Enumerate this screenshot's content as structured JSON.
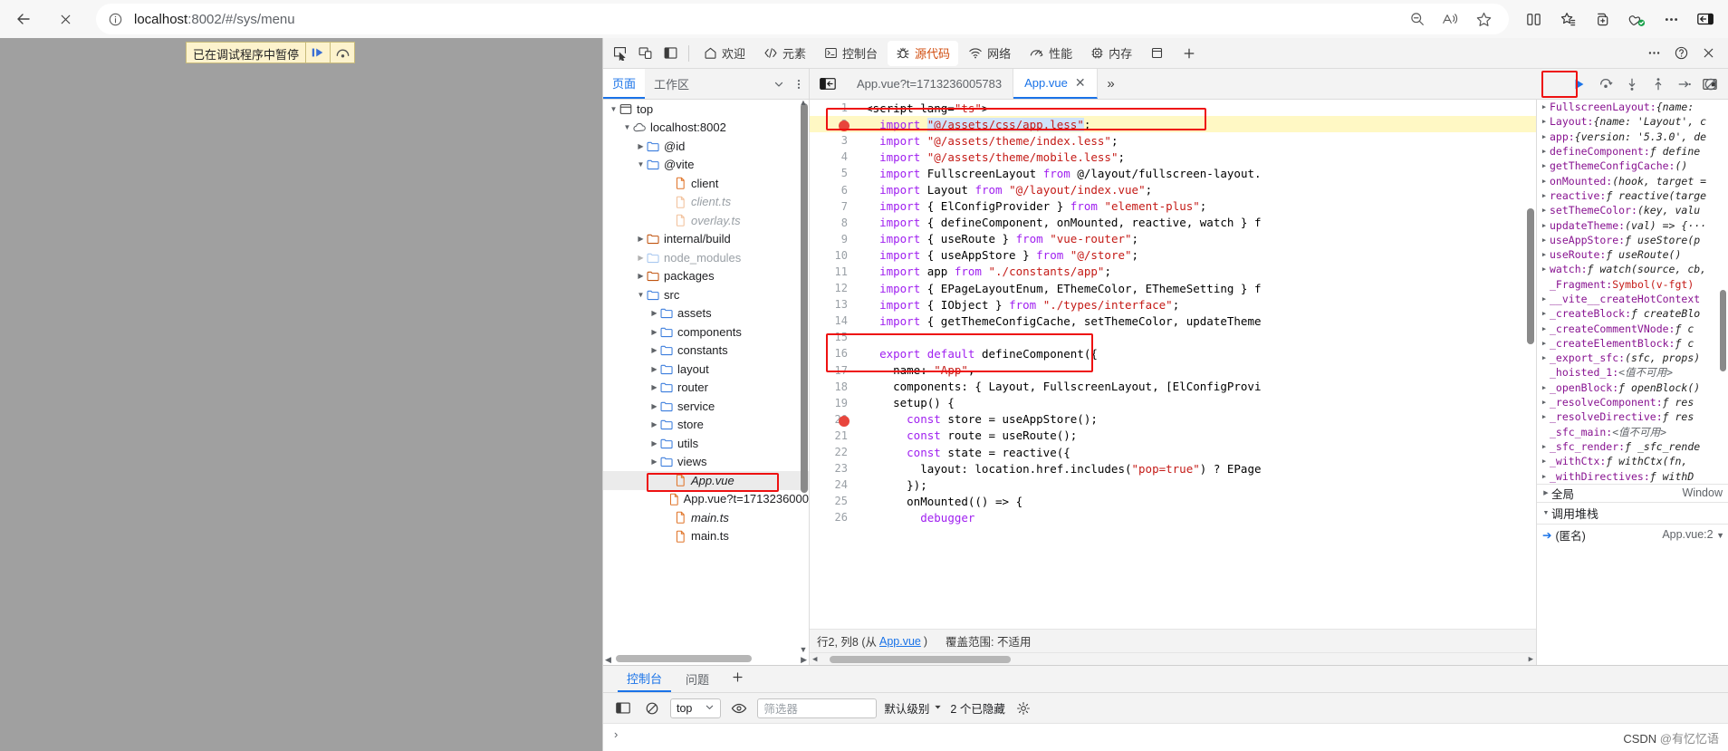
{
  "browser": {
    "back_label": "back-arrow",
    "stop_label": "stop",
    "url_prefix": "localhost",
    "url_rest": ":8002/#/sys/menu",
    "icons": {
      "info": "info-icon",
      "zoom_out": "zoom-out-icon",
      "read_aloud": "read-aloud-icon",
      "favorite": "favorite-star-icon",
      "split_screen": "split-screen-icon",
      "collections": "collections-icon",
      "add_tab_group": "add-tab-group-icon",
      "browser_essentials": "browser-essentials-icon",
      "settings_more": "settings-and-more-icon",
      "sidebar": "sidebar-icon"
    }
  },
  "page_overlay": {
    "paused_text": "已在调试程序中暂停",
    "resume_icon": "resume-script-icon",
    "step_icon": "step-over-icon"
  },
  "devtools": {
    "toolbar_icons": {
      "inspect": "inspect-element-icon",
      "device": "device-toolbar-icon",
      "dock": "dock-side-icon",
      "more": "more-tools-icon",
      "help": "help-icon",
      "close": "close-devtools-icon",
      "add_panel": "add-panel-icon"
    },
    "tabs": [
      {
        "label": "欢迎",
        "icon": "home-icon",
        "active": false
      },
      {
        "label": "元素",
        "icon": "elements-icon",
        "active": false
      },
      {
        "label": "控制台",
        "icon": "console-icon",
        "active": false
      },
      {
        "label": "源代码",
        "icon": "sources-bug-icon",
        "active": true
      },
      {
        "label": "网络",
        "icon": "network-icon",
        "active": false
      },
      {
        "label": "性能",
        "icon": "performance-icon",
        "active": false
      },
      {
        "label": "内存",
        "icon": "memory-icon",
        "active": false
      },
      {
        "label": "应用",
        "icon": "application-icon",
        "active": false
      }
    ],
    "navigator": {
      "tabs": [
        {
          "label": "页面",
          "active": true
        },
        {
          "label": "工作区",
          "active": false
        }
      ],
      "chevron_icon": "chevron-down-icon",
      "more_icon": "more-options-icon"
    },
    "editor_tabs": {
      "show_navigator_icon": "show-navigator-icon",
      "tabs": [
        {
          "label": "App.vue?t=1713236005783",
          "active": false,
          "closable": false
        },
        {
          "label": "App.vue",
          "active": true,
          "closable": true
        }
      ],
      "more_icon": "more-tabs-icon",
      "popout_icon": "popout-editor-icon"
    },
    "debug_controls": [
      {
        "name": "resume-script-execution",
        "icon": "resume-icon",
        "highlighted": true
      },
      {
        "name": "step-over-next-function-call",
        "icon": "step-over-icon",
        "highlighted": false
      },
      {
        "name": "step-into-next-function-call",
        "icon": "step-into-icon",
        "highlighted": false
      },
      {
        "name": "step-out-of-current-function",
        "icon": "step-out-icon",
        "highlighted": false
      },
      {
        "name": "step",
        "icon": "step-icon",
        "highlighted": false
      },
      {
        "name": "deactivate-breakpoints",
        "icon": "deactivate-breakpoints-icon",
        "highlighted": false
      }
    ],
    "file_tree": [
      {
        "label": "top",
        "indent": 0,
        "arrow": "down",
        "icon": "frame-icon",
        "style": ""
      },
      {
        "label": "localhost:8002",
        "indent": 1,
        "arrow": "down",
        "icon": "cloud-icon",
        "style": ""
      },
      {
        "label": "@id",
        "indent": 2,
        "arrow": "right",
        "icon": "folder-blue",
        "style": ""
      },
      {
        "label": "@vite",
        "indent": 2,
        "arrow": "down",
        "icon": "folder-blue",
        "style": ""
      },
      {
        "label": "client",
        "indent": 4,
        "arrow": "none",
        "icon": "file-orange",
        "style": ""
      },
      {
        "label": "client.ts",
        "indent": 4,
        "arrow": "none",
        "icon": "file-orange-dim",
        "style": "gray"
      },
      {
        "label": "overlay.ts",
        "indent": 4,
        "arrow": "none",
        "icon": "file-orange-dim",
        "style": "gray"
      },
      {
        "label": "internal/build",
        "indent": 2,
        "arrow": "right",
        "icon": "folder-orange",
        "style": ""
      },
      {
        "label": "node_modules",
        "indent": 2,
        "arrow": "right-dim",
        "icon": "folder-blue-dim",
        "style": "gray2"
      },
      {
        "label": "packages",
        "indent": 2,
        "arrow": "right",
        "icon": "folder-orange",
        "style": ""
      },
      {
        "label": "src",
        "indent": 2,
        "arrow": "down",
        "icon": "folder-blue",
        "style": ""
      },
      {
        "label": "assets",
        "indent": 3,
        "arrow": "right",
        "icon": "folder-blue",
        "style": ""
      },
      {
        "label": "components",
        "indent": 3,
        "arrow": "right",
        "icon": "folder-blue",
        "style": ""
      },
      {
        "label": "constants",
        "indent": 3,
        "arrow": "right",
        "icon": "folder-blue",
        "style": ""
      },
      {
        "label": "layout",
        "indent": 3,
        "arrow": "right",
        "icon": "folder-blue",
        "style": ""
      },
      {
        "label": "router",
        "indent": 3,
        "arrow": "right",
        "icon": "folder-blue",
        "style": ""
      },
      {
        "label": "service",
        "indent": 3,
        "arrow": "right",
        "icon": "folder-blue",
        "style": ""
      },
      {
        "label": "store",
        "indent": 3,
        "arrow": "right",
        "icon": "folder-blue",
        "style": ""
      },
      {
        "label": "utils",
        "indent": 3,
        "arrow": "right",
        "icon": "folder-blue",
        "style": ""
      },
      {
        "label": "views",
        "indent": 3,
        "arrow": "right",
        "icon": "folder-blue",
        "style": ""
      },
      {
        "label": "App.vue",
        "indent": 4,
        "arrow": "none",
        "icon": "file-orange",
        "style": "ital",
        "selected": true
      },
      {
        "label": "App.vue?t=1713236000",
        "indent": 4,
        "arrow": "none",
        "icon": "file-orange",
        "style": ""
      },
      {
        "label": "main.ts",
        "indent": 4,
        "arrow": "none",
        "icon": "file-orange",
        "style": "ital"
      },
      {
        "label": "main.ts",
        "indent": 4,
        "arrow": "none",
        "icon": "file-orange",
        "style": ""
      }
    ],
    "code_lines": [
      {
        "n": 1,
        "text": "<script lang=\"ts\">"
      },
      {
        "n": 2,
        "text": "  import \"@/assets/css/app.less\";",
        "breakpoint": true,
        "highlight": true
      },
      {
        "n": 3,
        "text": "  import \"@/assets/theme/index.less\";"
      },
      {
        "n": 4,
        "text": "  import \"@/assets/theme/mobile.less\";"
      },
      {
        "n": 5,
        "text": "  import FullscreenLayout from \"@/layout/fullscreen-layout."
      },
      {
        "n": 6,
        "text": "  import Layout from \"@/layout/index.vue\";"
      },
      {
        "n": 7,
        "text": "  import { ElConfigProvider } from \"element-plus\";"
      },
      {
        "n": 8,
        "text": "  import { defineComponent, onMounted, reactive, watch } f"
      },
      {
        "n": 9,
        "text": "  import { useRoute } from \"vue-router\";"
      },
      {
        "n": 10,
        "text": "  import { useAppStore } from \"@/store\";"
      },
      {
        "n": 11,
        "text": "  import app from \"./constants/app\";"
      },
      {
        "n": 12,
        "text": "  import { EPageLayoutEnum, EThemeColor, EThemeSetting } f"
      },
      {
        "n": 13,
        "text": "  import { IObject } from \"./types/interface\";"
      },
      {
        "n": 14,
        "text": "  import { getThemeConfigCache, setThemeColor, updateTheme"
      },
      {
        "n": 15,
        "text": ""
      },
      {
        "n": 16,
        "text": "  export default defineComponent({"
      },
      {
        "n": 17,
        "text": "    name: \"App\","
      },
      {
        "n": 18,
        "text": "    components: { Layout, FullscreenLayout, [ElConfigProvi"
      },
      {
        "n": 19,
        "text": "    setup() {"
      },
      {
        "n": 20,
        "text": "      const store = useAppStore();",
        "breakpoint": true
      },
      {
        "n": 21,
        "text": "      const route = useRoute();"
      },
      {
        "n": 22,
        "text": "      const state = reactive({"
      },
      {
        "n": 23,
        "text": "        layout: location.href.includes(\"pop=true\") ? EPage"
      },
      {
        "n": 24,
        "text": "      });"
      },
      {
        "n": 25,
        "text": "      onMounted(() => {"
      },
      {
        "n": 26,
        "text": "        debugger"
      }
    ],
    "editor_status": {
      "position": "行2, 列8 (从",
      "file_link": "App.vue",
      "position_tail": ")",
      "coverage": "覆盖范围: 不适用"
    },
    "scope": {
      "rows": [
        {
          "arrow": true,
          "key": "FullscreenLayout",
          "val": "{name:"
        },
        {
          "arrow": true,
          "key": "Layout",
          "val": "{name: 'Layout', c"
        },
        {
          "arrow": true,
          "key": "app",
          "val": "{version: '5.3.0', de"
        },
        {
          "arrow": true,
          "key": "defineComponent",
          "val": "ƒ define"
        },
        {
          "arrow": true,
          "key": "getThemeConfigCache",
          "val": "()"
        },
        {
          "arrow": true,
          "key": "onMounted",
          "val": "(hook, target ="
        },
        {
          "arrow": true,
          "key": "reactive",
          "val": "ƒ reactive(targe"
        },
        {
          "arrow": true,
          "key": "setThemeColor",
          "val": "(key, valu"
        },
        {
          "arrow": true,
          "key": "updateTheme",
          "val": "(val) => {···"
        },
        {
          "arrow": true,
          "key": "useAppStore",
          "val": "ƒ useStore(p"
        },
        {
          "arrow": true,
          "key": "useRoute",
          "val": "ƒ useRoute()"
        },
        {
          "arrow": true,
          "key": "watch",
          "val": "ƒ watch(source, cb,"
        },
        {
          "arrow": false,
          "key": "_Fragment",
          "val": "Symbol(v-fgt)",
          "valRed": true
        },
        {
          "arrow": true,
          "key": "__vite__createHotContext",
          "val": ""
        },
        {
          "arrow": true,
          "key": "_createBlock",
          "val": "ƒ createBlo"
        },
        {
          "arrow": true,
          "key": "_createCommentVNode",
          "val": "ƒ c"
        },
        {
          "arrow": true,
          "key": "_createElementBlock",
          "val": "ƒ c"
        },
        {
          "arrow": true,
          "key": "_export_sfc",
          "val": "(sfc, props)"
        },
        {
          "arrow": false,
          "key": "_hoisted_1",
          "val": "<值不可用>",
          "valGray": true
        },
        {
          "arrow": true,
          "key": "_openBlock",
          "val": "ƒ openBlock()"
        },
        {
          "arrow": true,
          "key": "_resolveComponent",
          "val": "ƒ res"
        },
        {
          "arrow": true,
          "key": "_resolveDirective",
          "val": "ƒ res"
        },
        {
          "arrow": false,
          "key": "_sfc_main",
          "val": "<值不可用>",
          "valGray": true
        },
        {
          "arrow": true,
          "key": "_sfc_render",
          "val": "ƒ _sfc_rende"
        },
        {
          "arrow": true,
          "key": "_withCtx",
          "val": "ƒ withCtx(fn, "
        },
        {
          "arrow": true,
          "key": "_withDirectives",
          "val": "ƒ withD"
        }
      ],
      "global_label": "全局",
      "global_value": "Window",
      "call_stack_label": "调用堆栈",
      "stack_frame": "(匿名)",
      "stack_location": "App.vue:2",
      "stack_chevron": "chevron-down-icon"
    },
    "drawer": {
      "tabs": [
        {
          "label": "控制台",
          "active": true
        },
        {
          "label": "问题",
          "active": false
        }
      ],
      "add_icon": "add-tool-icon",
      "toggle_sidebar_icon": "console-sidebar-icon",
      "clear_icon": "clear-console-icon",
      "context": "top",
      "context_chevron": "chevron-down-icon",
      "eye_icon": "live-expression-icon",
      "filter_placeholder": "筛选器",
      "level": "默认级别",
      "level_chevron": "chevron-down-icon",
      "hidden_messages": "2 个已隐藏",
      "settings_icon": "console-settings-icon",
      "prompt": "›"
    }
  },
  "watermark": {
    "prefix": "CSDN ",
    "handle": "@有忆忆语"
  }
}
